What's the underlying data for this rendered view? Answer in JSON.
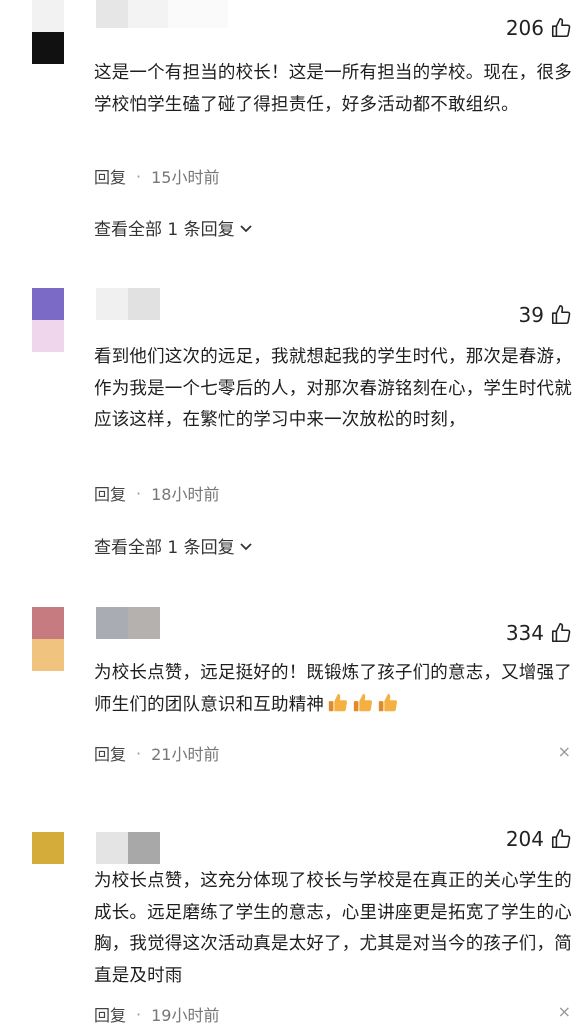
{
  "comments": [
    {
      "likes": "206",
      "text": "这是一个有担当的校长！这是一所有担当的学校。现在，很多学校怕学生磕了碰了得担责任，好多活动都不敢组织。",
      "reply_label": "回复",
      "time": "15小时前",
      "view_replies": "查看全部 1 条回复",
      "avatar_colors": [
        "#f2f2f2",
        "#111111"
      ]
    },
    {
      "likes": "39",
      "text": "看到他们这次的远足，我就想起我的学生时代，那次是春游，作为我是一个七零后的人，对那次春游铭刻在心，学生时代就应该这样，在繁忙的学习中来一次放松的时刻，",
      "reply_label": "回复",
      "time": "18小时前",
      "view_replies": "查看全部 1 条回复",
      "avatar_colors": [
        "#7b6ac6",
        "#f0d6ec"
      ]
    },
    {
      "likes": "334",
      "text": "为校长点赞，远足挺好的！既锻炼了孩子们的意志，又增强了师生们的团队意识和互助精神",
      "reply_label": "回复",
      "time": "21小时前",
      "close": "×",
      "avatar_colors": [
        "#c57b7f",
        "#f0c47e"
      ]
    },
    {
      "likes": "204",
      "text": "为校长点赞，这充分体现了校长与学校是在真正的关心学生的成长。远足磨练了学生的意志，心里讲座更是拓宽了学生的心胸，我觉得这次活动真是太好了，尤其是对当今的孩子们，简直是及时雨",
      "reply_label": "回复",
      "time": "19小时前",
      "close": "×",
      "avatar_colors": [
        "#d4ac3a",
        "#ffffff"
      ]
    }
  ],
  "icons": {
    "like": "thumbs-up-icon",
    "chevron": "chevron-down-icon",
    "emoji": "thumbs-up-emoji"
  },
  "colors": {
    "text": "#1e1e1e",
    "meta": "#777777",
    "emoji": "#f0a030"
  }
}
